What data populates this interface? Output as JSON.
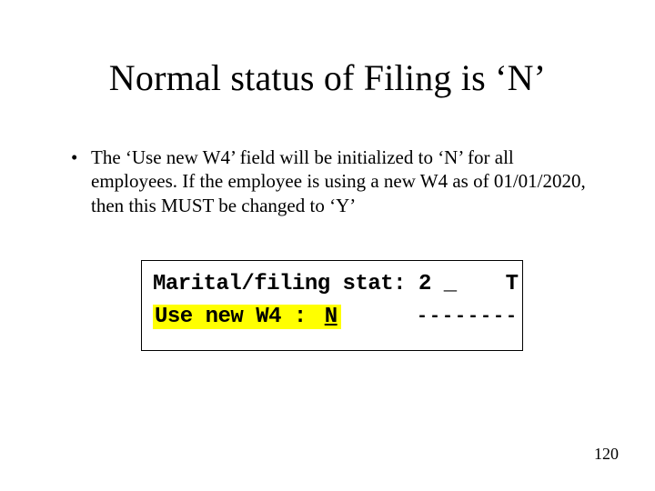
{
  "title": "Normal status of Filing is ‘N’",
  "bullet": "The ‘Use new W4’ field will be initialized to ‘N’ for all employees.  If the employee is using a new W4 as of 01/01/2020, then this MUST be changed to ‘Y’",
  "terminal": {
    "row1": {
      "label": "Marital/filing stat:",
      "value": "2 _"
    },
    "row2": {
      "label": "Use new W4 :",
      "value": "N"
    },
    "right_top": "T",
    "right_bot": "--------"
  },
  "page_number": "120"
}
